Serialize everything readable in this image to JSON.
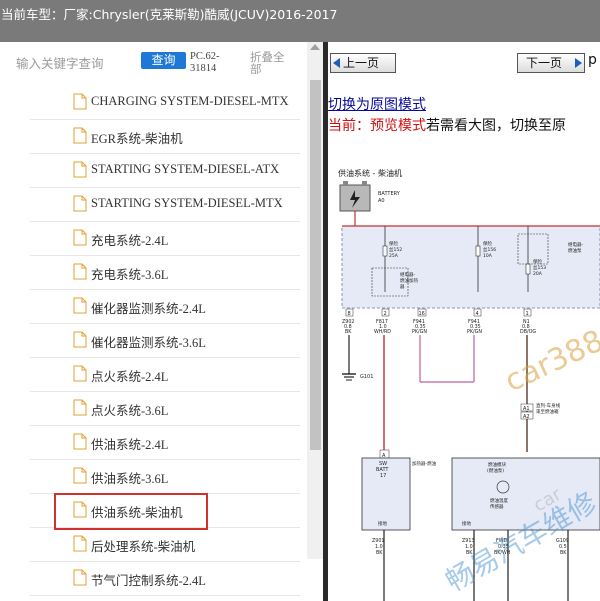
{
  "header": {
    "car_label": "当前车型：",
    "car_model": "厂家:Chrysler(克莱斯勒)酷威(JCUV)2016-2017"
  },
  "search": {
    "placeholder": "输入关键字查询",
    "query_button": "查询",
    "code": "PC.62-31814",
    "collapse_all": "折叠全部"
  },
  "tree": {
    "items": [
      {
        "label": "CHARGING SYSTEM-DIESEL-MTX"
      },
      {
        "label": "EGR系统-柴油机"
      },
      {
        "label": "STARTING SYSTEM-DIESEL-ATX"
      },
      {
        "label": "STARTING SYSTEM-DIESEL-MTX"
      },
      {
        "label": "充电系统-2.4L"
      },
      {
        "label": "充电系统-3.6L"
      },
      {
        "label": "催化器监测系统-2.4L"
      },
      {
        "label": "催化器监测系统-3.6L"
      },
      {
        "label": "点火系统-2.4L"
      },
      {
        "label": "点火系统-3.6L"
      },
      {
        "label": "供油系统-2.4L"
      },
      {
        "label": "供油系统-3.6L"
      },
      {
        "label": "供油系统-柴油机",
        "selected": true
      },
      {
        "label": "后处理系统-柴油机"
      },
      {
        "label": "节气门控制系统-2.4L"
      }
    ]
  },
  "viewer": {
    "prev_button": "上一页",
    "next_button": "下一页",
    "right_extra": "p",
    "switch_mode_link": "切换为原图模式",
    "current_label": "当前：",
    "preview_mode": "预览模式",
    "hint_text": "若需看大图，切换至原"
  },
  "diagram": {
    "title": "供油系统 - 柴油机",
    "battery_label": "BATTERY",
    "battery_code": "A0",
    "fuse1": "保险\n丝152\n25A",
    "fuse2": "保险\n丝156\n10A",
    "fuse3": "保险\n丝153\n20A",
    "relay_label": "继电器-\n燃油加热\n器",
    "relay2_label": "继电器-\n燃油泵",
    "pin_labels": [
      "8",
      "2",
      "16",
      "4",
      "1"
    ],
    "wire_codes": [
      {
        "code": "Z902",
        "gauge": "0.8",
        "color": "BK"
      },
      {
        "code": "F817",
        "gauge": "1.0",
        "color": "WH/RD"
      },
      {
        "code": "F941",
        "gauge": "0.35",
        "color": "PK/GN"
      },
      {
        "code": "F941",
        "gauge": "0.35",
        "color": "PK/GN"
      },
      {
        "code": "N1",
        "gauge": "0.8",
        "color": "DB/OG"
      }
    ],
    "ground1": "G101",
    "connector_a": "A",
    "connector_a1": "A1",
    "connector_a2": "A2",
    "sw_batt": "SW\nBATT\n17",
    "heater_label": "加热器-燃油",
    "module_label": "燃油模块\n(燃油泵)",
    "sensor_label": "燃油温度\n传感器",
    "inline_label": "直列-车身线\n束至燃油箱",
    "ground_label1": "接地",
    "ground_label2": "接地",
    "bottom_wires": [
      {
        "code": "Z913",
        "gauge": "1.0",
        "color": "BK"
      },
      {
        "code": "Z913",
        "gauge": "1.0",
        "color": "BK"
      },
      {
        "code": "FWD",
        "gauge": "0.35",
        "color": "BK/WH"
      },
      {
        "code": "G109",
        "gauge": "0.5",
        "color": "BK"
      }
    ],
    "watermark1": "car388",
    "watermark2": "畅易汽车维修",
    "watermark3": "car"
  }
}
